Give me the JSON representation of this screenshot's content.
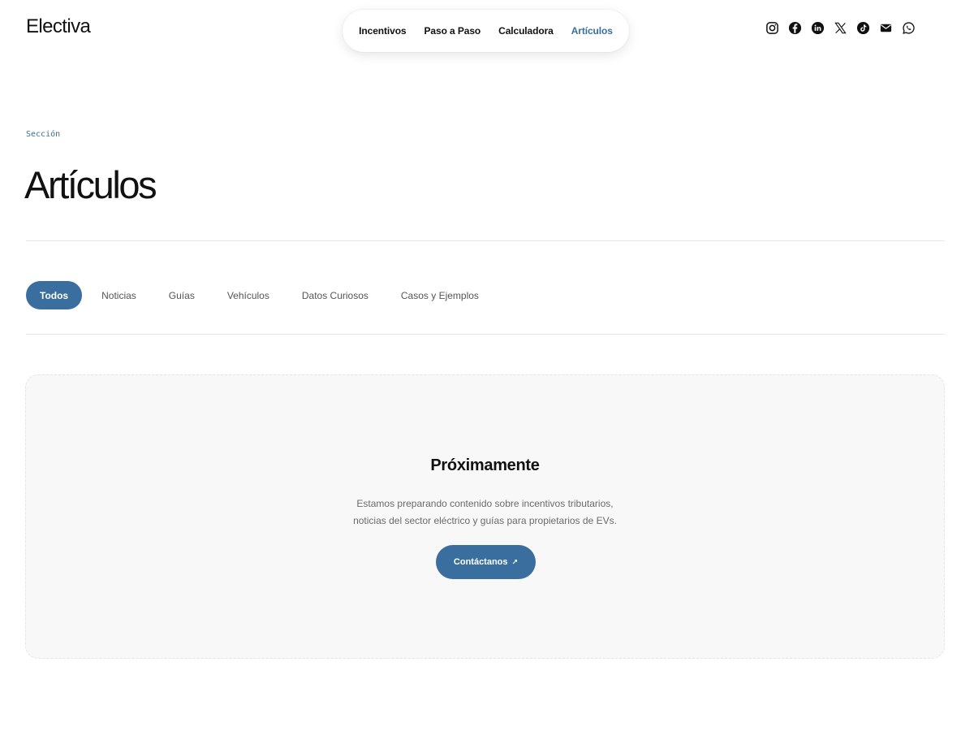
{
  "brand": {
    "logo_text": "Electiva"
  },
  "nav": {
    "items": [
      {
        "label": "Incentivos",
        "active": false
      },
      {
        "label": "Paso a Paso",
        "active": false
      },
      {
        "label": "Calculadora",
        "active": false
      },
      {
        "label": "Artículos",
        "active": true
      }
    ]
  },
  "socials": [
    "instagram-icon",
    "facebook-icon",
    "linkedin-icon",
    "x-icon",
    "tiktok-icon",
    "email-icon",
    "whatsapp-icon"
  ],
  "section": {
    "eyebrow": "Sección",
    "title": "Artículos"
  },
  "tabs": {
    "items": [
      {
        "label": "Todos",
        "active": true
      },
      {
        "label": "Noticias",
        "active": false
      },
      {
        "label": "Guías",
        "active": false
      },
      {
        "label": "Vehículos",
        "active": false
      },
      {
        "label": "Datos Curiosos",
        "active": false
      },
      {
        "label": "Casos y Ejemplos",
        "active": false
      }
    ]
  },
  "empty_state": {
    "title": "Próximamente",
    "line1": "Estamos preparando contenido sobre incentivos tributarios,",
    "line2": "noticias del sector eléctrico y guías para propietarios de EVs.",
    "cta_label": "Contáctanos",
    "cta_arrow": "↗"
  },
  "colors": {
    "accent": "#3a6e9e",
    "text": "#111111",
    "muted": "#6a6a6a",
    "card_bg": "#f8f8f9"
  }
}
